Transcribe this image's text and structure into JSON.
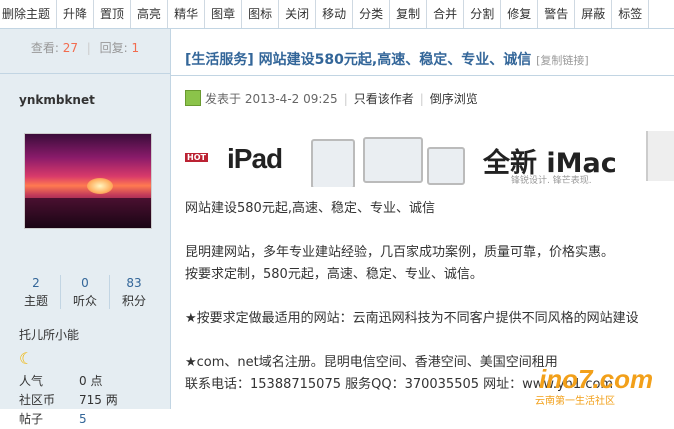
{
  "toolbar": {
    "items": [
      "删除主题",
      "升降",
      "置顶",
      "高亮",
      "精华",
      "图章",
      "图标",
      "关闭",
      "移动",
      "分类",
      "复制",
      "合并",
      "分割",
      "修复",
      "警告",
      "屏蔽",
      "标签"
    ]
  },
  "thread_stats": {
    "view_label": "查看:",
    "views": "27",
    "reply_label": "回复:",
    "replies": "1"
  },
  "author": {
    "username": "ynkmbknet",
    "stats": [
      {
        "value": "2",
        "label": "主题"
      },
      {
        "value": "0",
        "label": "听众"
      },
      {
        "value": "83",
        "label": "积分"
      }
    ],
    "title": "托儿所小能",
    "icon": "moon-icon",
    "profile": [
      {
        "key": "人气",
        "value": "0 点"
      },
      {
        "key": "社区币",
        "value": "715 两"
      },
      {
        "key": "帖子",
        "value": "5"
      }
    ]
  },
  "thread": {
    "title": "[生活服务] 网站建设580元起,高速、稳定、专业、诚信",
    "copy_link": "[复制链接]"
  },
  "post": {
    "posted_on": "发表于 2013-4-2 09:25",
    "only_author": "只看该作者",
    "reverse": "倒序浏览",
    "hot_label": "HOT",
    "ad": {
      "ipad": "iPad",
      "imac": "全新 iMac",
      "imac_sub": "锋锐设计. 锋芒表现."
    },
    "lines": [
      "网站建设580元起,高速、稳定、专业、诚信",
      "",
      "昆明建网站，多年专业建站经验，几百家成功案例，质量可靠，价格实惠。",
      "按要求定制，580元起，高速、稳定、专业、诚信。",
      "",
      "★按要求定做最适用的网站：云南迅网科技为不同客户提供不同风格的网站建设",
      "",
      "★com、net域名注册。昆明电信空间、香港空间、美国空间租用",
      "联系电话：15388715075  服务QQ：370035505  网址：www.yn1.com"
    ]
  },
  "watermark": {
    "main": "ino7.com",
    "sub": "云南第一生活社区"
  }
}
